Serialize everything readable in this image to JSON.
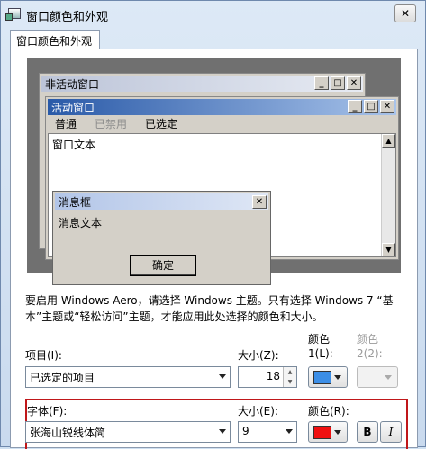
{
  "window": {
    "title": "窗口颜色和外观",
    "close_glyph": "✕"
  },
  "tabs": [
    {
      "label": "窗口颜色和外观"
    }
  ],
  "preview": {
    "inactive_title": "非活动窗口",
    "active_title": "活动窗口",
    "menu": {
      "normal": "普通",
      "disabled": "已禁用",
      "selected": "已选定"
    },
    "window_text": "窗口文本",
    "message_box_title": "消息框",
    "message_text": "消息文本",
    "ok_label": "确定",
    "titlebar_buttons": {
      "minimize": "_",
      "maximize": "□",
      "close": "✕"
    }
  },
  "description": "要启用 Windows Aero，请选择 Windows 主题。只有选择 Windows 7 “基本”主题或“轻松访问”主题，才能应用此处选择的颜色和大小。",
  "item": {
    "label": "项目(I):",
    "value": "已选定的项目",
    "size_label": "大小(Z):",
    "size_value": "18",
    "color1_label_top": "颜色",
    "color1_label": "1(L):",
    "color1": "#3c8ee6",
    "color2_label_top": "颜色",
    "color2_label": "2(2):"
  },
  "font": {
    "label": "字体(F):",
    "value": "张海山锐线体简",
    "size_label": "大小(E):",
    "size_value": "9",
    "color_label": "颜色(R):",
    "color": "#f01010",
    "bold_label": "B",
    "italic_label": "I"
  },
  "accent": {
    "highlight_border": "#c0171a"
  }
}
